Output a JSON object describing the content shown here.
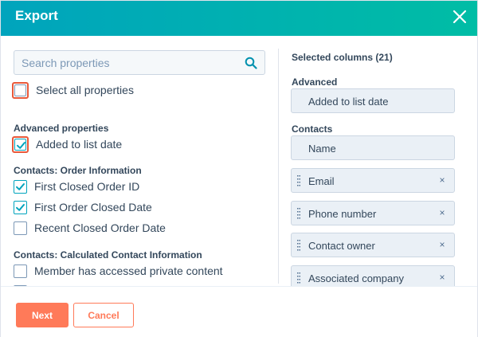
{
  "header": {
    "title": "Export",
    "close_icon": "close-icon"
  },
  "search": {
    "placeholder": "Search properties",
    "value": "",
    "icon": "search-icon"
  },
  "select_all": {
    "label": "Select all properties",
    "checked": false
  },
  "groups": [
    {
      "title": "Advanced properties",
      "items": [
        {
          "label": "Added to list date",
          "checked": true
        }
      ]
    },
    {
      "title": "Contacts: Order Information",
      "items": [
        {
          "label": "First Closed Order ID",
          "checked": true
        },
        {
          "label": "First Order Closed Date",
          "checked": true
        },
        {
          "label": "Recent Closed Order Date",
          "checked": false
        }
      ]
    },
    {
      "title": "Contacts: Calculated Contact Information",
      "items": [
        {
          "label": "Member has accessed private content",
          "checked": false
        }
      ]
    }
  ],
  "selected": {
    "heading": "Selected columns (21)",
    "sections": [
      {
        "title": "Advanced",
        "columns": [
          {
            "label": "Added to list date",
            "removable": false
          }
        ]
      },
      {
        "title": "Contacts",
        "columns": [
          {
            "label": "Name",
            "removable": false
          },
          {
            "label": "Email",
            "removable": true
          },
          {
            "label": "Phone number",
            "removable": true
          },
          {
            "label": "Contact owner",
            "removable": true
          },
          {
            "label": "Associated company",
            "removable": true
          }
        ]
      }
    ],
    "remove_symbol": "×"
  },
  "footer": {
    "next_label": "Next",
    "cancel_label": "Cancel"
  },
  "colors": {
    "header_start": "#00a4bd",
    "header_end": "#00bda5",
    "accent": "#ff7a59",
    "highlight": "#e8593b",
    "check": "#00a4bd"
  }
}
